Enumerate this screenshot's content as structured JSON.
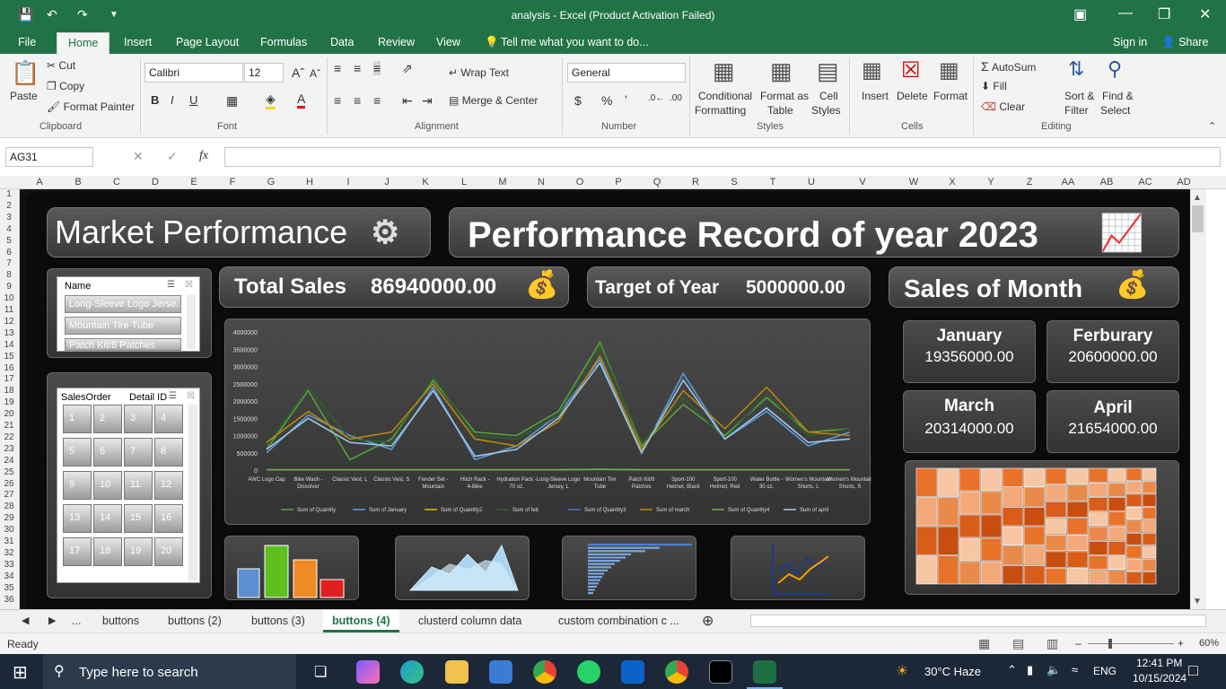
{
  "window": {
    "title": "analysis - Excel (Product Activation Failed)"
  },
  "ribbon_tabs": [
    "File",
    "Home",
    "Insert",
    "Page Layout",
    "Formulas",
    "Data",
    "Review",
    "View"
  ],
  "tell_me": "Tell me what you want to do...",
  "sign_in": "Sign in",
  "share": "Share",
  "clipboard": {
    "paste": "Paste",
    "cut": "Cut",
    "copy": "Copy",
    "format_painter": "Format Painter",
    "group": "Clipboard"
  },
  "font": {
    "name": "Calibri",
    "size": "12",
    "group": "Font"
  },
  "alignment": {
    "wrap_text": "Wrap Text",
    "merge_center": "Merge & Center",
    "group": "Alignment"
  },
  "number": {
    "format": "General",
    "group": "Number"
  },
  "styles": {
    "conditional": "Conditional",
    "formatting": "Formatting",
    "format_as": "Format as",
    "table": "Table",
    "cell": "Cell",
    "cell_styles": "Styles",
    "group": "Styles"
  },
  "cells": {
    "insert": "Insert",
    "delete": "Delete",
    "format": "Format",
    "group": "Cells"
  },
  "editing": {
    "autosum": "AutoSum",
    "fill": "Fill",
    "clear": "Clear",
    "sort_filter": "Sort &",
    "filter": "Filter",
    "find_select": "Find &",
    "select": "Select",
    "group": "Editing"
  },
  "formula_bar": {
    "name_box": "AG31",
    "fx": "fx",
    "formula": ""
  },
  "columns": [
    "A",
    "B",
    "C",
    "D",
    "E",
    "F",
    "G",
    "H",
    "I",
    "J",
    "K",
    "L",
    "M",
    "N",
    "O",
    "P",
    "Q",
    "R",
    "S",
    "T",
    "U",
    "V",
    "W",
    "X",
    "Y",
    "Z",
    "AA",
    "AB",
    "AC",
    "AD"
  ],
  "rows": [
    "1",
    "2",
    "3",
    "4",
    "5",
    "6",
    "7",
    "8",
    "9",
    "10",
    "11",
    "12",
    "13",
    "14",
    "15",
    "16",
    "17",
    "18",
    "19",
    "20",
    "21",
    "22",
    "23",
    "24",
    "25",
    "26",
    "27",
    "28",
    "29",
    "30",
    "31",
    "32",
    "33",
    "34",
    "35",
    "36"
  ],
  "dashboard": {
    "market_title": "Market Performance",
    "record_title": "Performance Record of year 2023",
    "total_sales_label": "Total Sales",
    "total_sales_value": "86940000.00",
    "target_label": "Target of Year",
    "target_value": "5000000.00",
    "sales_month_label": "Sales of Month",
    "months": [
      {
        "name": "January",
        "value": "19356000.00"
      },
      {
        "name": "Ferburary",
        "value": "20600000.00"
      },
      {
        "name": "March",
        "value": "20314000.00"
      },
      {
        "name": "April",
        "value": "21654000.00"
      }
    ],
    "slicer_name": {
      "header": "Name",
      "items": [
        "Long-Sleeve Logo Jerse...",
        "Mountain Tire Tube",
        "Patch Kit/8 Patches"
      ]
    },
    "slicer_sales": {
      "header1": "SalesOrder",
      "header2": "Detail ID",
      "items": [
        "1",
        "2",
        "3",
        "4",
        "5",
        "6",
        "7",
        "8",
        "9",
        "10",
        "11",
        "12",
        "13",
        "14",
        "15",
        "16",
        "17",
        "18",
        "19",
        "20"
      ]
    }
  },
  "chart_data": {
    "type": "line",
    "categories": [
      "AWC Logo Cap",
      "Bike Wash - Dissolver",
      "Classic Vest, L",
      "Classic Vest, S",
      "Fender Set - Mountain",
      "Hitch Rack - 4-Bike",
      "Hydration Pack - 70 oz.",
      "Long-Sleeve Logo Jersey, L",
      "Mountain Tire Tube",
      "Patch Kit/8 Patches",
      "Sport-100 Helmet, Black",
      "Sport-100 Helmet, Red",
      "Water Bottle - 30 oz.",
      "Women's Mountain Shorts, L",
      "Women's Mountain Shorts, S"
    ],
    "yticks": [
      "4000000",
      "3500000",
      "3000000",
      "2500000",
      "2000000",
      "1500000",
      "1000000",
      "500000",
      "0"
    ],
    "ylim": [
      0,
      4000000
    ],
    "series": [
      {
        "name": "Sum of Quantity",
        "color": "#5b9e3a",
        "values": [
          600000,
          2300000,
          300000,
          900000,
          2600000,
          1100000,
          1000000,
          1700000,
          3700000,
          700000,
          1900000,
          1000000,
          2100000,
          1100000,
          1200000
        ]
      },
      {
        "name": "Sum of January",
        "color": "#5b9bd5",
        "values": [
          500000,
          1600000,
          1000000,
          600000,
          2400000,
          300000,
          700000,
          1600000,
          3200000,
          500000,
          2800000,
          900000,
          1700000,
          700000,
          1100000
        ]
      },
      {
        "name": "Sum of Quantity2",
        "color": "#e0b000",
        "values": [
          10000,
          10000,
          10000,
          10000,
          10000,
          10000,
          10000,
          10000,
          20000,
          10000,
          10000,
          10000,
          10000,
          10000,
          10000
        ]
      },
      {
        "name": "Sum of feb",
        "color": "#2e5f2e",
        "values": [
          700000,
          2400000,
          900000,
          800000,
          2700000,
          1000000,
          900000,
          1600000,
          3600000,
          800000,
          2100000,
          900000,
          2200000,
          1000000,
          1200000
        ]
      },
      {
        "name": "Sum of Quantity3",
        "color": "#4472c4",
        "values": [
          10000,
          10000,
          10000,
          10000,
          10000,
          10000,
          10000,
          10000,
          20000,
          10000,
          10000,
          10000,
          10000,
          10000,
          10000
        ]
      },
      {
        "name": "Sum of march",
        "color": "#b8860b",
        "values": [
          800000,
          1700000,
          900000,
          1100000,
          2500000,
          900000,
          700000,
          1400000,
          3300000,
          600000,
          2300000,
          1200000,
          2400000,
          1100000,
          1000000
        ]
      },
      {
        "name": "Sum of Quantity4",
        "color": "#70ad47",
        "values": [
          10000,
          10000,
          10000,
          10000,
          10000,
          10000,
          10000,
          10000,
          20000,
          10000,
          10000,
          10000,
          10000,
          10000,
          10000
        ]
      },
      {
        "name": "Sum of april",
        "color": "#9dc3e6",
        "values": [
          600000,
          1500000,
          800000,
          700000,
          2300000,
          400000,
          600000,
          1500000,
          3100000,
          500000,
          2600000,
          900000,
          1800000,
          800000,
          900000
        ]
      }
    ]
  },
  "sheet_tabs": [
    "...",
    "buttons",
    "buttons (2)",
    "buttons (3)",
    "buttons (4)",
    "clusterd column data",
    "custom combination c ..."
  ],
  "status": {
    "ready": "Ready",
    "zoom": "60%"
  },
  "taskbar": {
    "search": "Type here to search",
    "weather": "30°C  Haze",
    "lang": "ENG",
    "time": "12:41 PM",
    "date": "10/15/2024"
  }
}
